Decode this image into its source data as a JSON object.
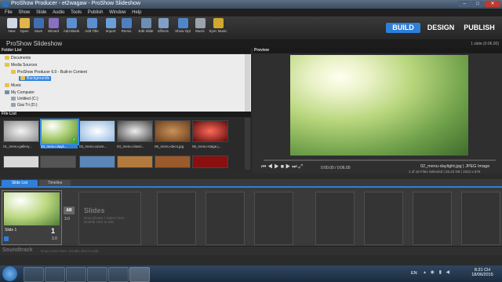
{
  "window": {
    "title": "ProShow Producer - et2wagaw - ProShow Slideshow"
  },
  "menu": [
    "File",
    "Show",
    "Slide",
    "Audio",
    "Tools",
    "Publish",
    "Window",
    "Help"
  ],
  "toolbar": {
    "tools": [
      "New",
      "Open",
      "Save",
      "Wizard",
      "Add Blank",
      "Add Title",
      "Import",
      "Remix",
      "Edit Slide",
      "Effects",
      "Show Opt",
      "Music",
      "Sync Music"
    ]
  },
  "modes": {
    "build": "BUILD",
    "design": "DESIGN",
    "publish": "PUBLISH"
  },
  "show": {
    "title": "ProShow Slideshow",
    "count": "1 slide (0:06.00)"
  },
  "folder_list": {
    "header": "Folder List",
    "items": [
      "Documents",
      "Media Sources",
      "ProShow Producer 6.0 - Built-in Content",
      "Backgrounds",
      "Music",
      "My Computer",
      "Untitled (C:)",
      "Giai Tri (D:)"
    ]
  },
  "file_list": {
    "header": "File List",
    "files": [
      "01_menu-gallery...",
      "02_menu-dayli...",
      "03_menu-azure...",
      "04_menu-classi...",
      "05_menu-deco.jpg",
      "06_menu-stage.j..."
    ]
  },
  "preview": {
    "header": "Preview",
    "time": "0:00.00 / 0:06.00",
    "filename": "02_menu-daylight.jpg",
    "filetype": "JPEG Image",
    "details": "1 of 16 Files Selected | 25.22 KB | 1024 x 576"
  },
  "tabs": {
    "slide_list": "Slide List",
    "timeline": "Timeline"
  },
  "slides": {
    "slide_name": "Slide 1",
    "slide_number": "1",
    "transition_label": "AB",
    "transition_time": "3.0",
    "duration": "3.0",
    "placeholder_title": "Slides",
    "placeholder_text": "Drop photos / videos here. Double click to edit."
  },
  "soundtrack": {
    "label": "Soundtrack",
    "hint": "Drop music here.  Double click to edit."
  },
  "taskbar": {
    "lang": "EN",
    "time": "8:21 CH",
    "date": "18/06/2015"
  },
  "colors": {
    "accent": "#2f7fd8",
    "selection": "#3a8ee6",
    "bg": "#2b2b2b"
  }
}
